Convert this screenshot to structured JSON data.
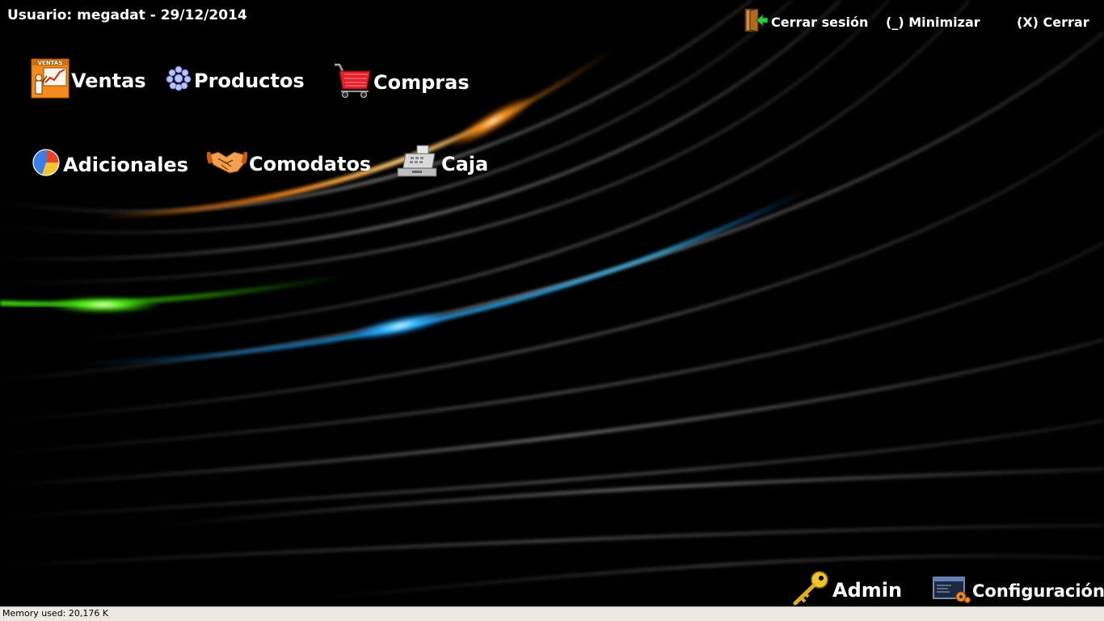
{
  "header": {
    "user_line": "Usuario: megadat - 29/12/2014",
    "logout_label": "Cerrar sesión",
    "minimize_label": "(_) Minimizar",
    "close_label": "(X) Cerrar"
  },
  "menu": {
    "ventas": {
      "label": "Ventas",
      "icon": "sales-chart-icon",
      "icon_caption": "VENTAS"
    },
    "productos": {
      "label": "Productos",
      "icon": "products-icon"
    },
    "compras": {
      "label": "Compras",
      "icon": "shopping-cart-icon"
    },
    "adicionales": {
      "label": "Adicionales",
      "icon": "pie-chart-icon"
    },
    "comodatos": {
      "label": "Comodatos",
      "icon": "handshake-icon"
    },
    "caja": {
      "label": "Caja",
      "icon": "cash-register-icon"
    }
  },
  "footer_actions": {
    "admin_label": "Admin",
    "config_label": "Configuración"
  },
  "status_bar": {
    "memory": "Memory used: 20,176 K"
  },
  "colors": {
    "background": "#000000",
    "orange_streak": "#ff8c1a",
    "green_streak": "#5cff2a",
    "blue_streak": "#1aa8ff",
    "status_bar": "#ece9e2"
  }
}
